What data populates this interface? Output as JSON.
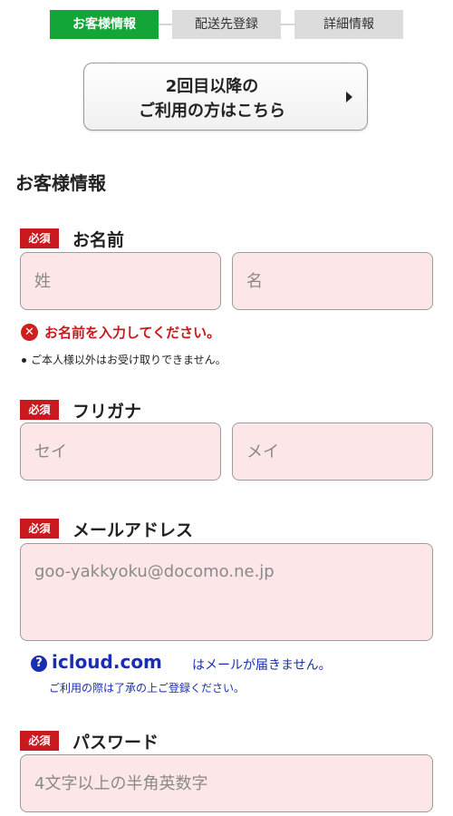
{
  "steps": [
    "お客様情報",
    "配送先登録",
    "詳細情報"
  ],
  "repeat_button": {
    "line1": "2回目以降の",
    "line2": "ご利用の方はこちら"
  },
  "section_title": "お客様情報",
  "required_badge": "必須",
  "name": {
    "label": "お名前",
    "last_placeholder": "姓",
    "first_placeholder": "名",
    "error": "お名前を入力してください。",
    "note": "ご本人様以外はお受け取りできません。"
  },
  "furigana": {
    "label": "フリガナ",
    "last_placeholder": "セイ",
    "first_placeholder": "メイ"
  },
  "email": {
    "label": "メールアドレス",
    "placeholder": "goo-yakkyoku@docomo.ne.jp",
    "warning_domain": "icloud.com",
    "warning_rest": "はメールが届きません。",
    "warning_sub": "ご利用の際は了承の上ご登録ください。"
  },
  "password": {
    "label": "パスワード",
    "placeholder": "4文字以上の半角英数字"
  }
}
